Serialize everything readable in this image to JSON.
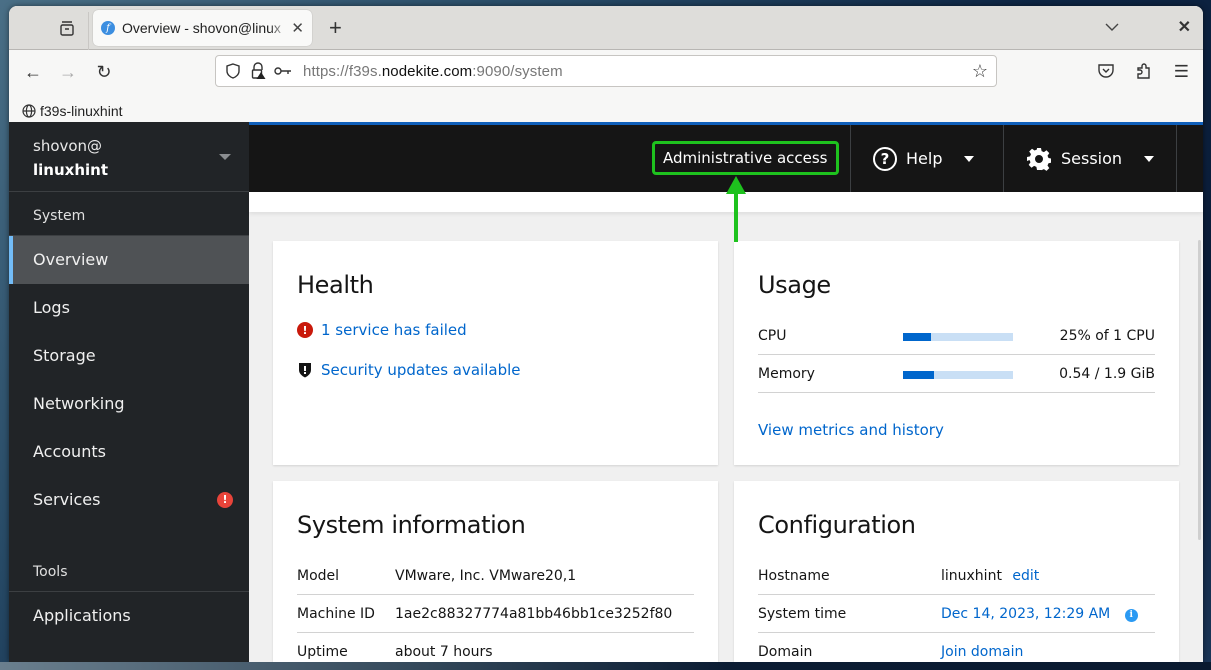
{
  "browser": {
    "tab": {
      "title": "Overview - shovon@linux",
      "favicon_icon": "fedora-icon"
    },
    "new_tab_label": "+",
    "url": {
      "prefix": "https://f39s.",
      "domain": "nodekite.com",
      "suffix": ":9090/system"
    },
    "bookmarks": [
      {
        "label": "f39s-linuxhint",
        "icon": "globe-icon"
      }
    ]
  },
  "sidebar": {
    "host": {
      "user": "shovon@",
      "name": "linuxhint"
    },
    "sections": [
      {
        "title": "System",
        "items": [
          {
            "label": "Overview",
            "active": true
          },
          {
            "label": "Logs"
          },
          {
            "label": "Storage"
          },
          {
            "label": "Networking"
          },
          {
            "label": "Accounts"
          },
          {
            "label": "Services",
            "badge": "!"
          }
        ]
      },
      {
        "title": "Tools",
        "items": [
          {
            "label": "Applications"
          }
        ]
      }
    ]
  },
  "topbar": {
    "admin_access": "Administrative access",
    "help": "Help",
    "session": "Session",
    "highlight_color": "#1ec21e"
  },
  "health": {
    "title": "Health",
    "items": [
      {
        "icon": "error-circle-icon",
        "text": "1 service has failed"
      },
      {
        "icon": "shield-icon",
        "text": "Security updates available"
      }
    ]
  },
  "usage": {
    "title": "Usage",
    "rows": [
      {
        "label": "CPU",
        "fraction": 0.25,
        "value": "25% of 1 CPU"
      },
      {
        "label": "Memory",
        "fraction": 0.28,
        "value": "0.54 / 1.9 GiB"
      }
    ],
    "link": "View metrics and history"
  },
  "system_information": {
    "title": "System information",
    "rows": [
      {
        "label": "Model",
        "value": "VMware, Inc. VMware20,1"
      },
      {
        "label": "Machine ID",
        "value": "1ae2c88327774a81bb46bb1ce3252f80"
      },
      {
        "label": "Uptime",
        "value": "about 7 hours"
      }
    ]
  },
  "configuration": {
    "title": "Configuration",
    "hostname": {
      "label": "Hostname",
      "value": "linuxhint",
      "action": "edit"
    },
    "system_time": {
      "label": "System time",
      "value": "Dec 14, 2023, 12:29 AM"
    },
    "domain": {
      "label": "Domain",
      "value": "Join domain"
    }
  }
}
